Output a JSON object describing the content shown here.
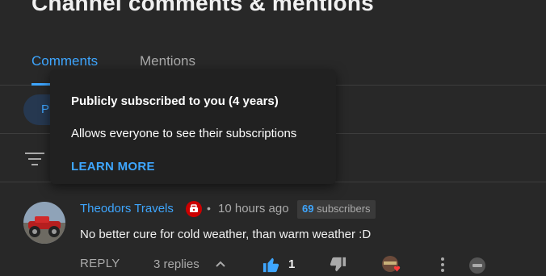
{
  "page": {
    "title": "Channel comments & mentions"
  },
  "tabs": [
    {
      "label": "Comments",
      "active": true
    },
    {
      "label": "Mentions",
      "active": false
    }
  ],
  "chip": {
    "label": "P"
  },
  "popover": {
    "title": "Publicly subscribed to you (4 years)",
    "description": "Allows everyone to see their subscriptions",
    "link": "LEARN MORE"
  },
  "comment": {
    "author": "Theodors Travels",
    "separator": "•",
    "time": "10 hours ago",
    "subscribers": {
      "count": "69",
      "label": "subscribers"
    },
    "text": "No better cure for cold weather, than warm weather :D",
    "actions": {
      "reply": "REPLY",
      "replies": "3 replies",
      "likes": "1"
    }
  },
  "icons": {
    "filter": "filter-icon",
    "subscriber_badge": "subscriber-badge-icon",
    "chevron": "chevron-up-icon",
    "like": "thumbs-up-icon",
    "dislike": "thumbs-down-icon",
    "heart": "creator-heart-icon",
    "more": "more-vertical-icon",
    "moderation": "moderation-icon"
  },
  "colors": {
    "background": "#282828",
    "accent": "#3ea6ff",
    "popover_bg": "#212121",
    "muted_text": "#aaaaaa",
    "badge_red": "#cc0000"
  }
}
